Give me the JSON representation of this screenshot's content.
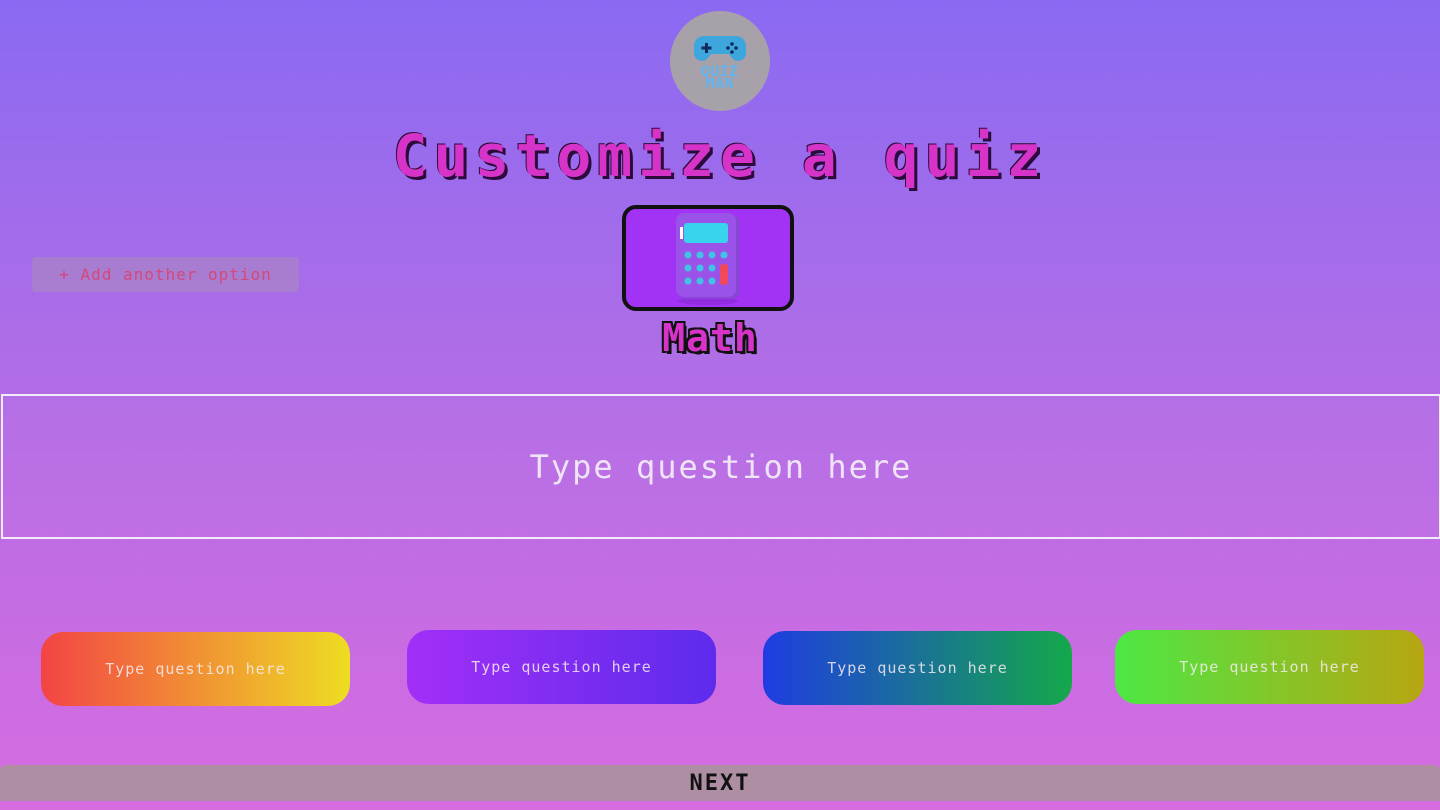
{
  "logo": {
    "text_line1": "QUIZ",
    "text_line2": "MAN",
    "icon": "gamepad-icon"
  },
  "title": "Customize a quiz",
  "add_option_label": "+ Add another option",
  "subject": {
    "label": "Math",
    "icon": "calculator-icon"
  },
  "question": {
    "placeholder": "Type question here"
  },
  "answers": [
    {
      "placeholder": "Type question here",
      "colors": [
        "#f34445",
        "#eedd22"
      ]
    },
    {
      "placeholder": "Type question here",
      "colors": [
        "#a22ff7",
        "#5d2bec"
      ]
    },
    {
      "placeholder": "Type question here",
      "colors": [
        "#1f3ce2",
        "#14a84a"
      ]
    },
    {
      "placeholder": "Type question here",
      "colors": [
        "#4ce844",
        "#b7a611"
      ]
    }
  ],
  "next_label": "NEXT",
  "colors": {
    "title": "#d633c9",
    "add_option_text": "#d6477a",
    "next_bg": "#ae8ea3"
  }
}
